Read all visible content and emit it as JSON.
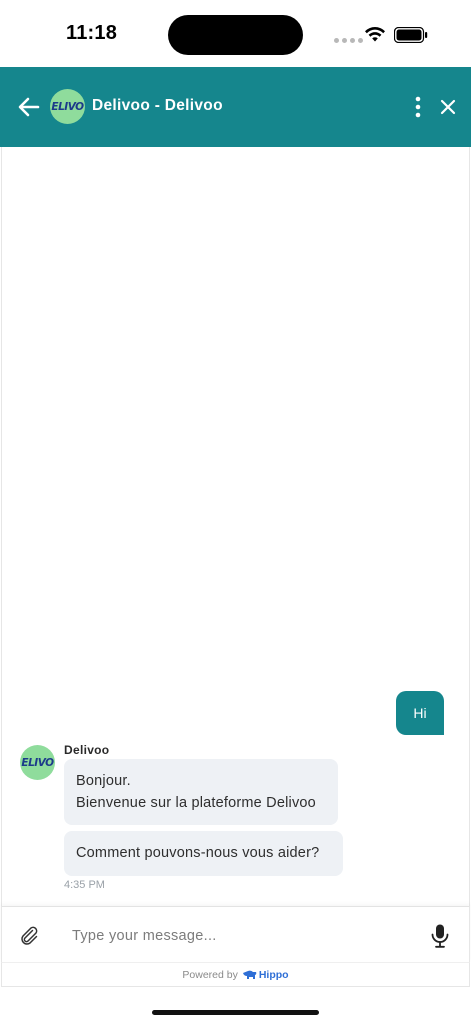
{
  "status_bar": {
    "time": "11:18"
  },
  "header": {
    "title": "Delivoo - Delivoo",
    "logo_text": "ELIVO",
    "color": "#15868d"
  },
  "conversation": {
    "outgoing": [
      {
        "text": "Hi"
      }
    ],
    "incoming": {
      "sender": "Delivoo",
      "avatar_logo_text": "ELIVO",
      "messages": [
        {
          "lines": [
            "Bonjour.",
            "Bienvenue sur la plateforme Delivoo"
          ]
        },
        {
          "lines": [
            "Comment pouvons-nous vous aider?"
          ]
        }
      ],
      "time": "4:35 PM"
    }
  },
  "composer": {
    "placeholder": "Type your message..."
  },
  "footer": {
    "powered_by": "Powered by",
    "brand": "Hippo"
  },
  "icons": {
    "back": "arrow-left-icon",
    "more": "more-vertical-icon",
    "close": "close-icon",
    "attach": "paperclip-icon",
    "mic": "microphone-icon"
  }
}
